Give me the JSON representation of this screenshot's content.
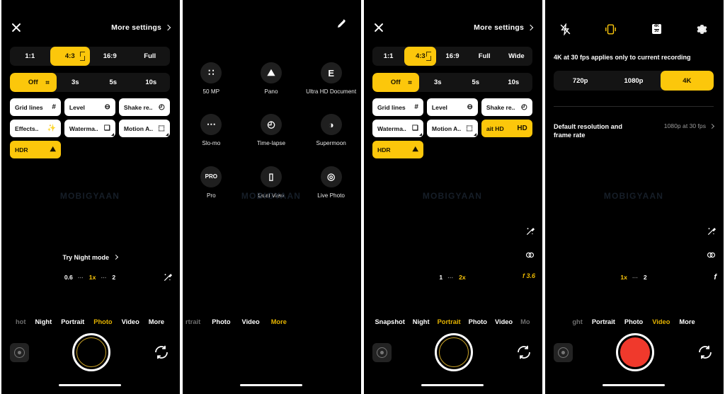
{
  "theme": {
    "accent": "#FCC70B",
    "accent_dim": "#E6B400",
    "record_red": "#F0392C",
    "bg": "#000000"
  },
  "watermark": {
    "text": "MOBIGYAAN"
  },
  "panel1": {
    "header": {
      "close_icon": "close-icon",
      "more_settings_label": "More settings",
      "chevron_icon": "chevron-right-icon"
    },
    "aspect_ratios": [
      {
        "label": "1:1",
        "active": false
      },
      {
        "label": "4:3",
        "active": true
      },
      {
        "label": "16:9",
        "active": false
      },
      {
        "label": "Full",
        "active": false
      }
    ],
    "timer": [
      {
        "label": "Off",
        "active": true
      },
      {
        "label": "3s",
        "active": false
      },
      {
        "label": "5s",
        "active": false
      },
      {
        "label": "10s",
        "active": false
      }
    ],
    "toggles": [
      {
        "label": "Grid lines",
        "icon": "grid-icon",
        "glyph": "#",
        "on": false,
        "fold": false
      },
      {
        "label": "Level",
        "icon": "level-icon",
        "glyph": "⊖",
        "on": false,
        "fold": false
      },
      {
        "label": "Shake re..",
        "icon": "shake-reduction-icon",
        "glyph": "◴",
        "on": false,
        "fold": false
      },
      {
        "label": "Effects..",
        "icon": "effects-icon",
        "glyph": "✨",
        "on": false,
        "fold": false
      },
      {
        "label": "Waterma..",
        "icon": "watermark-icon",
        "glyph": "❑",
        "on": false,
        "fold": true
      },
      {
        "label": "Motion A..",
        "icon": "motion-auto-icon",
        "glyph": "⬚",
        "on": false,
        "fold": true
      },
      {
        "label": "HDR",
        "icon": "hdr-icon",
        "glyph": "⛰",
        "on": true,
        "fold": false
      }
    ],
    "viewfinder": {
      "try_night_label": "Try Night mode"
    },
    "zoom_levels": [
      {
        "label": "0.6",
        "active": false
      },
      {
        "label": "1x",
        "active": true
      },
      {
        "label": "2",
        "active": false
      }
    ],
    "modes": [
      {
        "label": "hot",
        "state": "edge"
      },
      {
        "label": "Night",
        "state": "normal"
      },
      {
        "label": "Portrait",
        "state": "normal"
      },
      {
        "label": "Photo",
        "state": "selected"
      },
      {
        "label": "Video",
        "state": "normal"
      },
      {
        "label": "More",
        "state": "normal"
      }
    ],
    "shutter": {
      "type": "photo"
    }
  },
  "panel2": {
    "edit_icon": "edit-pencil-icon",
    "modes": [
      {
        "label": "50 MP",
        "icon": "fifty-mp-icon",
        "glyph": "∷"
      },
      {
        "label": "Pano",
        "icon": "panorama-icon",
        "glyph": "⛰"
      },
      {
        "label": "Ultra HD Document",
        "icon": "document-icon",
        "glyph": "὜E"
      },
      {
        "label": "Slo-mo",
        "icon": "slow-motion-icon",
        "glyph": "⋯"
      },
      {
        "label": "Time-lapse",
        "icon": "time-lapse-icon",
        "glyph": "◴"
      },
      {
        "label": "Supermoon",
        "icon": "supermoon-icon",
        "glyph": "◑"
      },
      {
        "label": "Pro",
        "icon": "pro-mode-icon",
        "glyph": "PRO"
      },
      {
        "label": "Dual View",
        "icon": "dual-view-icon",
        "glyph": "▯"
      },
      {
        "label": "Live Photo",
        "icon": "live-photo-icon",
        "glyph": "◎"
      }
    ],
    "bottom_modes": [
      {
        "label": "rtrait",
        "state": "edge"
      },
      {
        "label": "Photo",
        "state": "normal"
      },
      {
        "label": "Video",
        "state": "normal"
      },
      {
        "label": "More",
        "state": "selected"
      }
    ]
  },
  "panel3": {
    "header": {
      "close_icon": "close-icon",
      "more_settings_label": "More settings",
      "chevron_icon": "chevron-right-icon"
    },
    "aspect_ratios": [
      {
        "label": "1:1",
        "active": false
      },
      {
        "label": "4:3",
        "active": true
      },
      {
        "label": "16:9",
        "active": false
      },
      {
        "label": "Full",
        "active": false
      },
      {
        "label": "Wide",
        "active": false
      }
    ],
    "timer": [
      {
        "label": "Off",
        "active": true
      },
      {
        "label": "3s",
        "active": false
      },
      {
        "label": "5s",
        "active": false
      },
      {
        "label": "10s",
        "active": false
      }
    ],
    "toggles": [
      {
        "label": "Grid lines",
        "icon": "grid-icon",
        "glyph": "#",
        "on": false,
        "fold": false
      },
      {
        "label": "Level",
        "icon": "level-icon",
        "glyph": "⊖",
        "on": false,
        "fold": false
      },
      {
        "label": "Shake re..",
        "icon": "shake-reduction-icon",
        "glyph": "◴",
        "on": false,
        "fold": false
      },
      {
        "label": "Waterma..",
        "icon": "watermark-icon",
        "glyph": "❑",
        "on": false,
        "fold": true
      },
      {
        "label": "Motion A..",
        "icon": "motion-auto-icon",
        "glyph": "⬚",
        "on": false,
        "fold": true
      },
      {
        "label": "ait  HD",
        "icon": "hd-portrait-icon",
        "glyph": "HD",
        "on": true,
        "fold": false
      },
      {
        "label": "HDR",
        "icon": "hdr-icon",
        "glyph": "⛰",
        "on": true,
        "fold": false
      }
    ],
    "zoom_levels": [
      {
        "label": "1",
        "active": false
      },
      {
        "label": "2x",
        "active": true
      }
    ],
    "aperture": "f 3.6",
    "modes": [
      {
        "label": "Snapshot",
        "state": "normal"
      },
      {
        "label": "Night",
        "state": "normal"
      },
      {
        "label": "Portrait",
        "state": "selected"
      },
      {
        "label": "Photo",
        "state": "normal"
      },
      {
        "label": "Video",
        "state": "normal"
      },
      {
        "label": "Mo",
        "state": "edge"
      }
    ],
    "shutter": {
      "type": "photo"
    }
  },
  "panel4": {
    "topbar": [
      {
        "icon": "flash-off-icon",
        "glyph": "⚡",
        "state": "off"
      },
      {
        "icon": "video-stabilization-icon",
        "glyph": "❙",
        "state": "on"
      },
      {
        "icon": "resolution-badge-icon",
        "top": "4K",
        "bottom": "30",
        "state": "normal"
      },
      {
        "icon": "gear-icon",
        "glyph": "⚙",
        "state": "normal"
      }
    ],
    "note": "4K at 30 fps applies only to current recording",
    "resolutions": [
      {
        "label": "720p",
        "active": false
      },
      {
        "label": "1080p",
        "active": false
      },
      {
        "label": "4K",
        "active": true
      }
    ],
    "default_setting": {
      "label": "Default resolution and frame rate",
      "value": "1080p at 30 fps",
      "chevron_icon": "chevron-right-icon"
    },
    "zoom_levels": [
      {
        "label": "1x",
        "active": true
      },
      {
        "label": "2",
        "active": false
      }
    ],
    "aperture": "f",
    "modes": [
      {
        "label": "ght",
        "state": "edge"
      },
      {
        "label": "Portrait",
        "state": "normal"
      },
      {
        "label": "Photo",
        "state": "normal"
      },
      {
        "label": "Video",
        "state": "selected"
      },
      {
        "label": "More",
        "state": "normal"
      }
    ],
    "shutter": {
      "type": "record"
    }
  },
  "side_icons": {
    "magic": "magic-wand-icon",
    "filter": "filter-icon",
    "aperture": "aperture-icon"
  }
}
